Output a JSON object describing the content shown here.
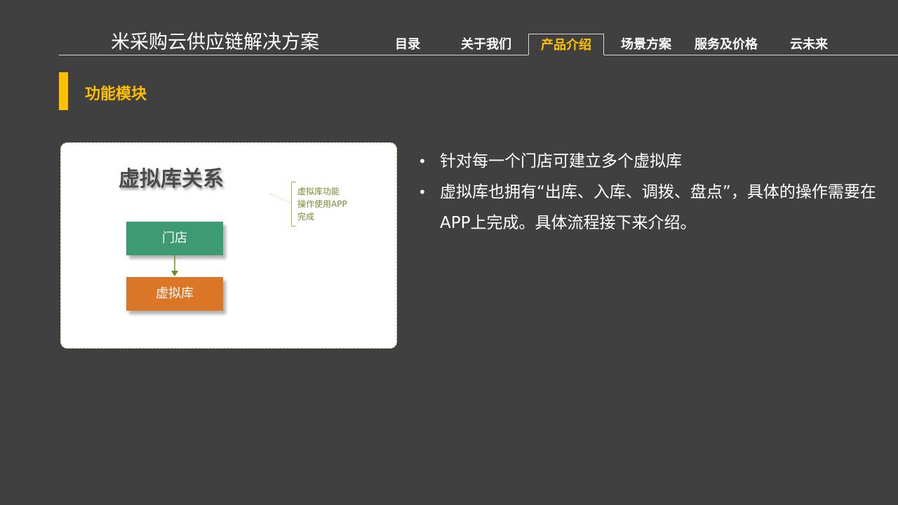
{
  "header": {
    "brand": "米采购云供应链解决方案",
    "nav": [
      {
        "label": "目录",
        "active": false
      },
      {
        "label": "关于我们",
        "active": false
      },
      {
        "label": "产品介绍",
        "active": true
      },
      {
        "label": "场景方案",
        "active": false
      },
      {
        "label": "服务及价格",
        "active": false
      },
      {
        "label": "云未来",
        "active": false
      }
    ]
  },
  "section": {
    "title": "功能模块"
  },
  "diagram": {
    "title": "虚拟库关系",
    "callout_lines": [
      "虚拟库功能",
      "操作使用APP",
      "完成"
    ],
    "nodes": [
      {
        "label": "门店",
        "color": "#3e9a72"
      },
      {
        "label": "虚拟库",
        "color": "#db7627"
      }
    ]
  },
  "bullets": [
    "针对每一个门店可建立多个虚拟库",
    "虚拟库也拥有“出库、入库、调拨、盘点”，具体的操作需要在APP上完成。具体流程接下来介绍。"
  ],
  "colors": {
    "background": "#404040",
    "accent": "#ffc000",
    "store_node": "#3e9a72",
    "virtual_warehouse_node": "#db7627"
  }
}
